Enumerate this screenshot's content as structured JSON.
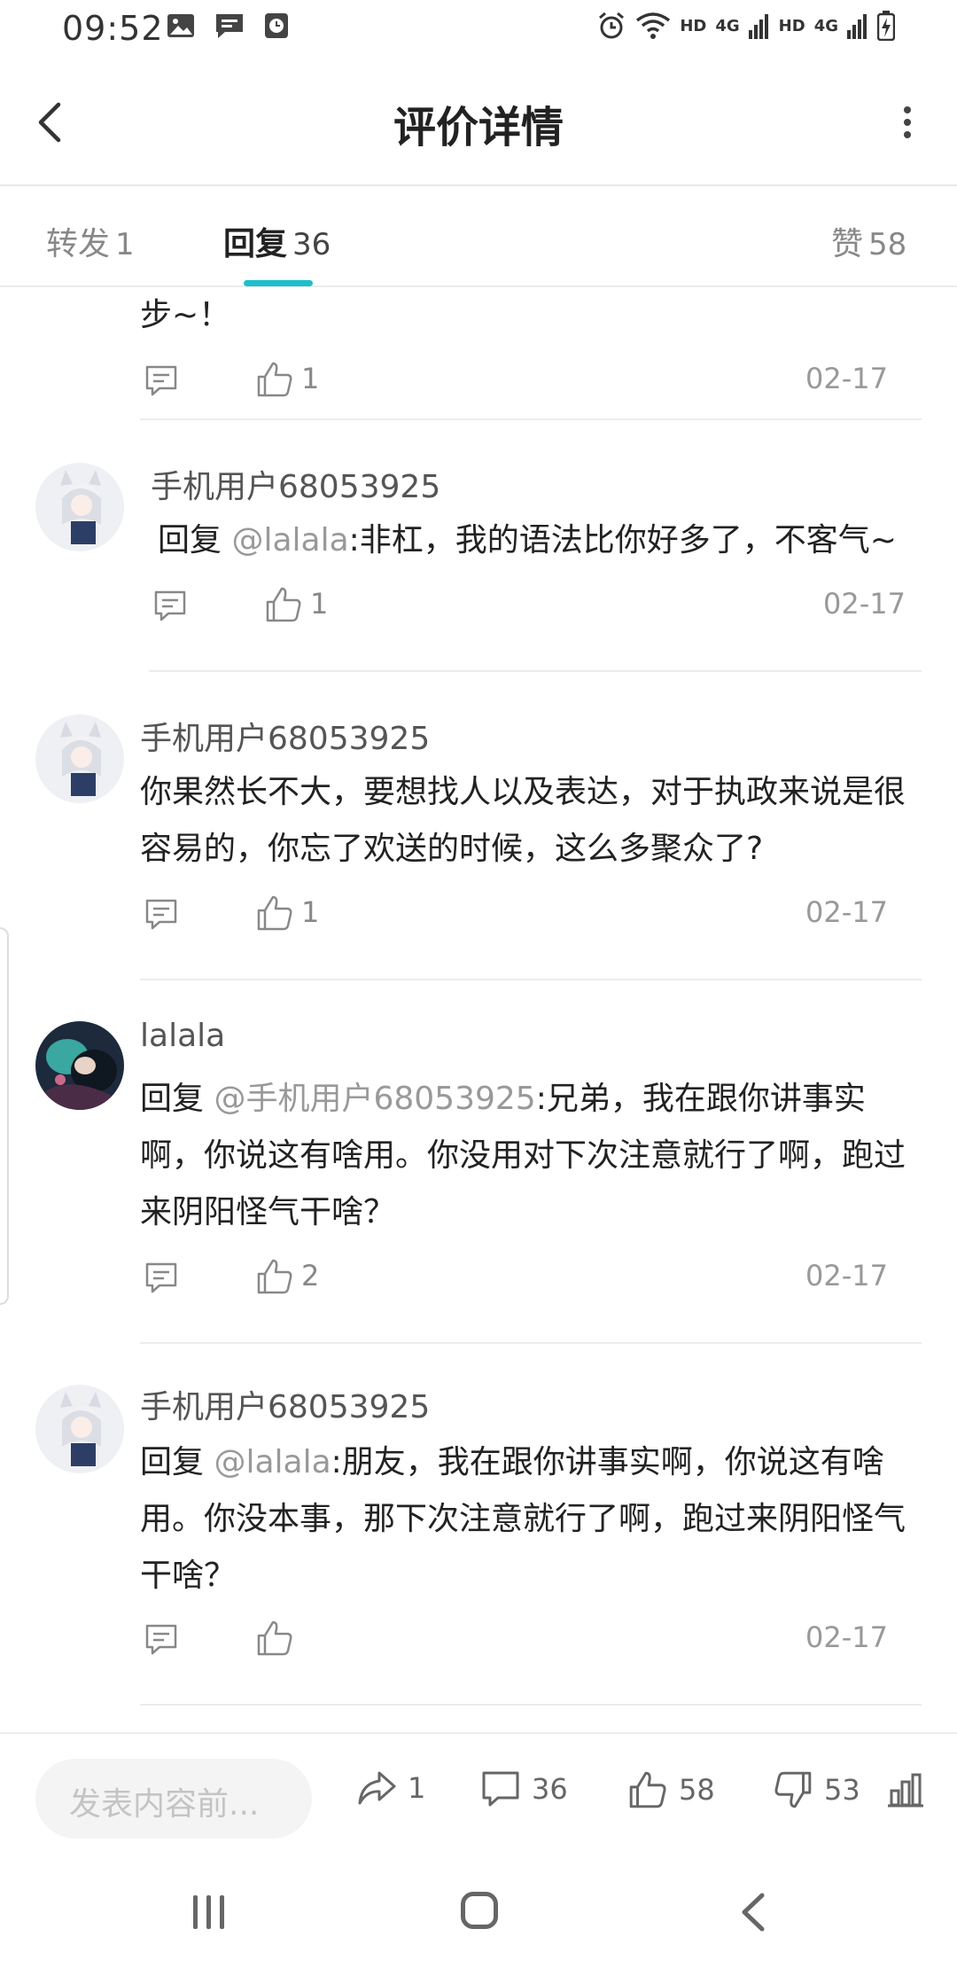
{
  "status_bar": {
    "time": "09:52",
    "icons_left": [
      "image-icon",
      "message-icon",
      "clock-icon"
    ],
    "icons_right": [
      "alarm-icon",
      "wifi-icon",
      "signal-icon",
      "signal-icon",
      "battery-icon"
    ],
    "hd1": "HD",
    "lte1": "4G",
    "hd2": "HD",
    "lte2": "4G"
  },
  "header": {
    "title": "评价详情"
  },
  "tabs": [
    {
      "label": "转发",
      "count": "1"
    },
    {
      "label": "回复",
      "count": "36"
    },
    {
      "label": "赞",
      "count": "58"
    }
  ],
  "comments": [
    {
      "username": "",
      "content_prefix": "",
      "mention": "",
      "content": "步~！",
      "likes": "1",
      "date": "02-17"
    },
    {
      "username": "手机用户68053925",
      "content_prefix": "回复 ",
      "mention": "@lalala",
      "content": ":非杠，我的语法比你好多了，不客气~",
      "likes": "1",
      "date": "02-17"
    },
    {
      "username": "手机用户68053925",
      "content_prefix": "",
      "mention": "",
      "content": "你果然长不大，要想找人以及表达，对于执政来说是很容易的，你忘了欢送的时候，这么多聚众了?",
      "likes": "1",
      "date": "02-17"
    },
    {
      "username": "lalala",
      "content_prefix": "回复 ",
      "mention": "@手机用户68053925",
      "content": ":兄弟，我在跟你讲事实啊，你说这有啥用。你没用对下次注意就行了啊，跑过来阴阳怪气干啥？",
      "likes": "2",
      "date": "02-17"
    },
    {
      "username": "手机用户68053925",
      "content_prefix": "回复 ",
      "mention": "@lalala",
      "content": ":朋友，我在跟你讲事实啊，你说这有啥用。你没本事，那下次注意就行了啊，跑过来阴阳怪气干啥？",
      "likes": "",
      "date": "02-17"
    }
  ],
  "action_bar": {
    "compose_placeholder": "发表内容前...",
    "forward_count": "1",
    "reply_count": "36",
    "like_count": "58",
    "dislike_count": "53"
  },
  "colors": {
    "accent": "#1ebecb",
    "mention": "#999999"
  }
}
